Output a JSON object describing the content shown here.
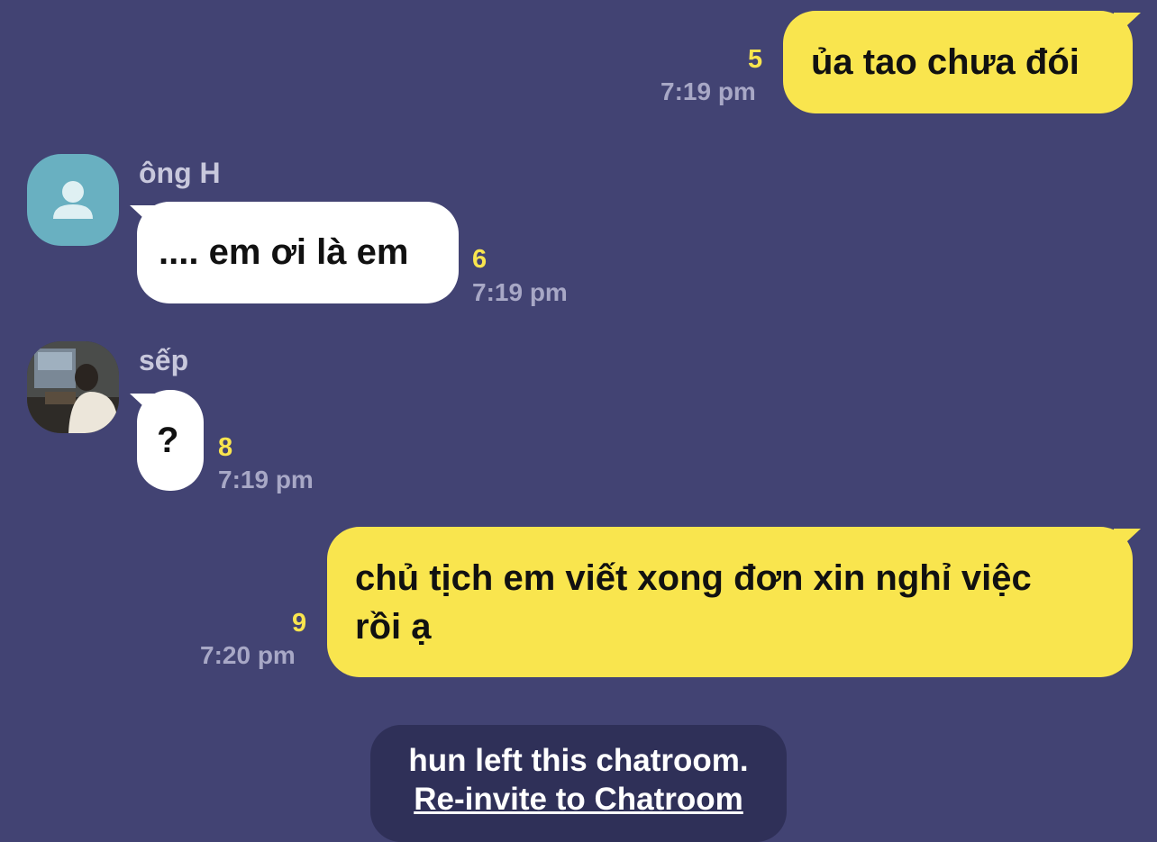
{
  "messages": [
    {
      "direction": "outgoing",
      "text": "ủa tao chưa đói",
      "unread_count": "5",
      "time": "7:19 pm"
    },
    {
      "direction": "incoming",
      "sender": "ông H",
      "avatar": "default-user-avatar",
      "text": ".... em ơi là em",
      "unread_count": "6",
      "time": "7:19 pm"
    },
    {
      "direction": "incoming",
      "sender": "sếp",
      "avatar": "photo-avatar",
      "text": "?",
      "unread_count": "8",
      "time": "7:19 pm"
    },
    {
      "direction": "outgoing",
      "text_line1": "chủ tịch em viết xong đơn xin nghỉ việc",
      "text_line2": "rồi ạ",
      "unread_count": "9",
      "time": "7:20 pm"
    }
  ],
  "notice": {
    "text": "hun left this chatroom.",
    "link": "Re-invite to Chatroom"
  },
  "colors": {
    "background": "#424373",
    "my_bubble": "#f9e54e",
    "their_bubble": "#ffffff",
    "unread": "#f9e54e",
    "notice_bg": "#2f3058"
  }
}
